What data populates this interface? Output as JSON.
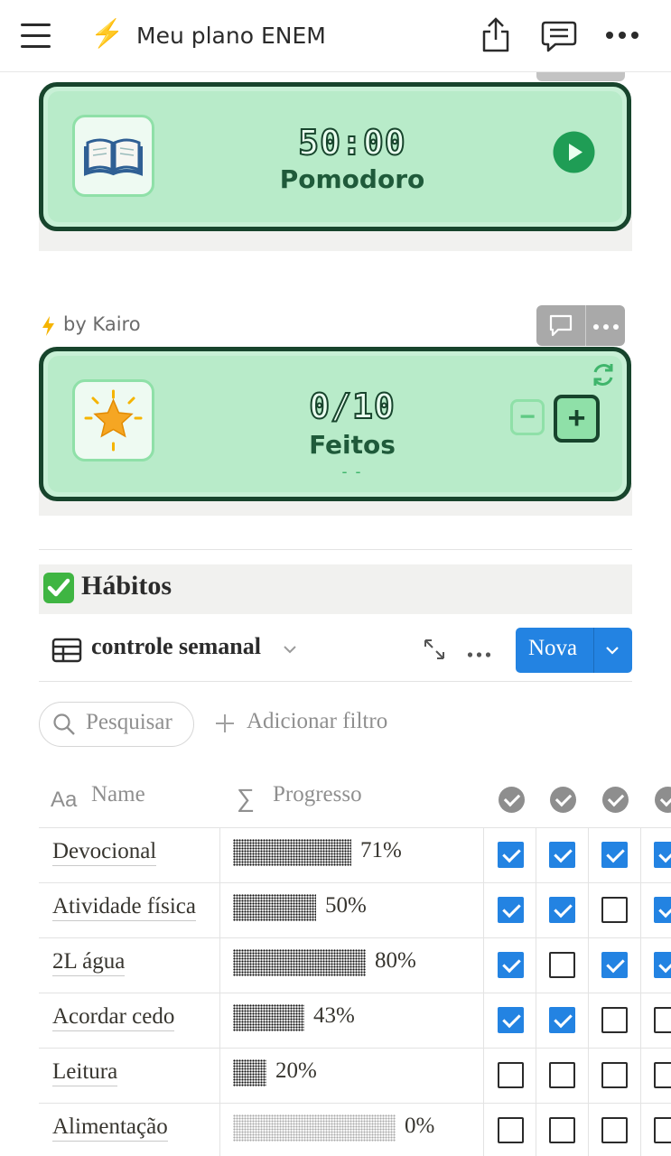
{
  "topbar": {
    "title": "Meu plano ENEM",
    "menu_icon": "menu-icon",
    "bolt_icon": "lightning-icon",
    "share_icon": "share-icon",
    "comment_icon": "comment-icon",
    "more_icon": "more-icon"
  },
  "pomodoro": {
    "time": "50:00",
    "label": "Pomodoro",
    "icon": "book-icon",
    "play_icon": "play-icon"
  },
  "byline": "by Kairo",
  "counter": {
    "value": "0/10",
    "label": "Feitos",
    "sub": "- -",
    "icon": "star-icon",
    "minus_label": "−",
    "plus_label": "+",
    "refresh_icon": "refresh-icon"
  },
  "habits": {
    "title": "Hábitos",
    "view_name": "controle semanal",
    "new_button": "Nova",
    "search_placeholder": "Pesquisar",
    "add_filter": "Adicionar filtro",
    "columns": {
      "name": "Name",
      "name_prefix": "Aa",
      "progress": "Progresso",
      "progress_prefix": "∑"
    },
    "rows": [
      {
        "name": "Devocional",
        "progress": 0.71,
        "pct": "71%",
        "days": [
          true,
          true,
          true,
          true
        ]
      },
      {
        "name": "Atividade física",
        "progress": 0.5,
        "pct": "50%",
        "days": [
          true,
          true,
          false,
          true
        ]
      },
      {
        "name": "2L água",
        "progress": 0.8,
        "pct": "80%",
        "days": [
          true,
          false,
          true,
          true
        ]
      },
      {
        "name": "Acordar cedo",
        "progress": 0.43,
        "pct": "43%",
        "days": [
          true,
          true,
          false,
          false
        ]
      },
      {
        "name": "Leitura",
        "progress": 0.2,
        "pct": "20%",
        "days": [
          false,
          false,
          false,
          false
        ]
      },
      {
        "name": "Alimentação",
        "progress": 0.0,
        "pct": "0%",
        "days": [
          false,
          false,
          false,
          false
        ]
      }
    ]
  },
  "colors": {
    "accent": "#2383e2",
    "widget_border": "#17442c",
    "widget_fill": "#b8ebc9",
    "play": "#1f9d55"
  }
}
